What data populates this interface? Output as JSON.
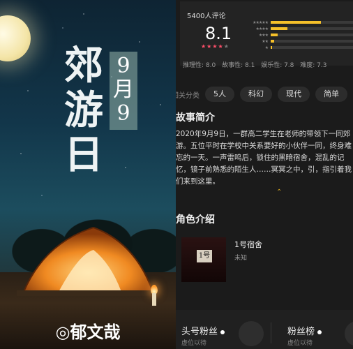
{
  "cover": {
    "title": "郊游日",
    "date": "9月9",
    "author": "◎郁文哉"
  },
  "rating": {
    "reviews": "5400人评论",
    "score": "8.1",
    "stars_on": 4,
    "stars_total": 5,
    "distribution": [
      0.6,
      0.2,
      0.08,
      0.04,
      0.02
    ],
    "sub_scores": [
      "推理性: 8.0",
      "故事性: 8.1",
      "娱乐性: 7.8",
      "难度: 7.3"
    ]
  },
  "tags": {
    "label": "相关分类",
    "items": [
      "5人",
      "科幻",
      "现代",
      "简单"
    ]
  },
  "synopsis": {
    "title": "故事简介",
    "text": "2020年9月9日，一群高二学生在老师的带领下一同郊游。五位平时在学校中关系要好的小伙伴一同，终身难忘的一天。一声雷鸣后，锁住的黑暗宿舍，混乱的记忆，镜子前熟悉的陌生人……冥冥之中，引，指引着我们来到这里。"
  },
  "characters": {
    "title": "角色介绍",
    "items": [
      {
        "name": "1号宿舍",
        "role": "未知",
        "sign": "1号"
      }
    ]
  },
  "bottom": {
    "fan_title": "头号粉丝",
    "fan_sub": "虚位以待",
    "rank_title": "粉丝榜",
    "rank_sub": "虚位以待"
  }
}
